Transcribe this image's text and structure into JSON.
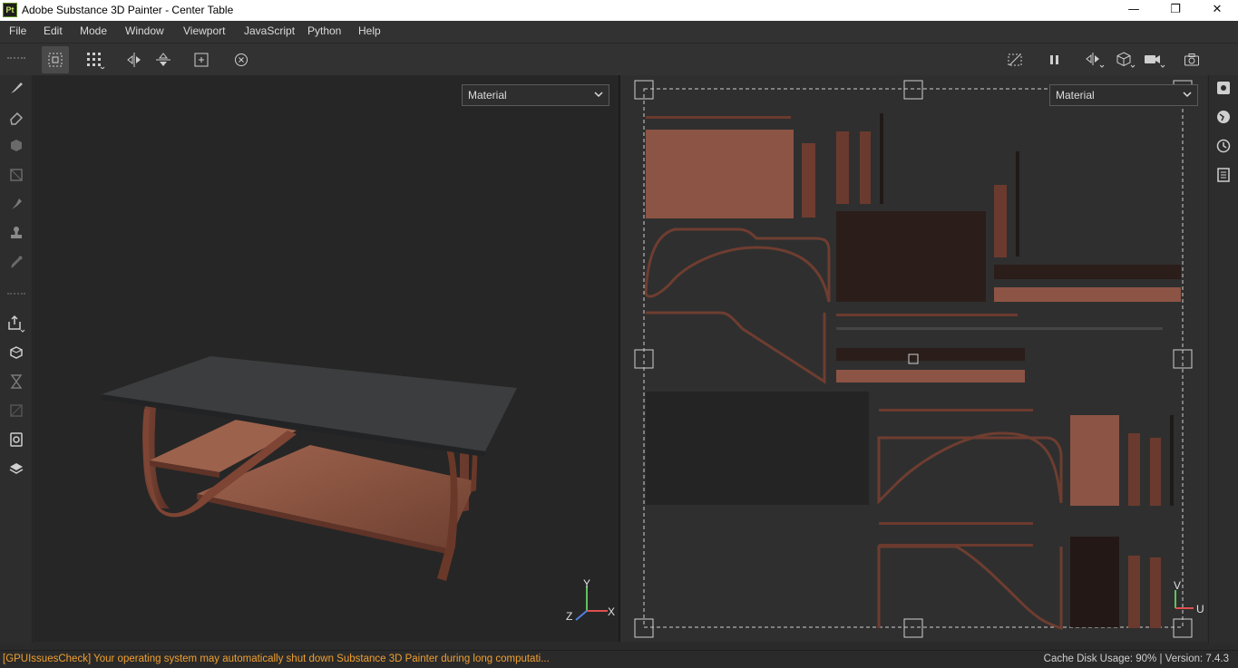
{
  "window": {
    "app_icon_text": "Pt",
    "title": "Adobe Substance 3D Painter - Center Table",
    "minimize": "—",
    "maximize": "❐",
    "close": "✕"
  },
  "menu": [
    "File",
    "Edit",
    "Mode",
    "Window",
    "Viewport",
    "JavaScript",
    "Python",
    "Help"
  ],
  "viewport3d": {
    "channel_dropdown": "Material",
    "axis": {
      "x": "X",
      "y": "Y",
      "z": "Z"
    }
  },
  "viewport2d": {
    "channel_dropdown": "Material",
    "axis": {
      "u": "U",
      "v": "V"
    }
  },
  "status": {
    "message": "[GPUIssuesCheck] Your operating system may automatically shut down Substance 3D Painter during long computati...",
    "cache_info": "Cache Disk Usage:   90% | Version: 7.4.3"
  },
  "colors": {
    "accent_warning": "#f0a030",
    "wood": "#8a5040",
    "tabletop": "#3b3d3e"
  }
}
